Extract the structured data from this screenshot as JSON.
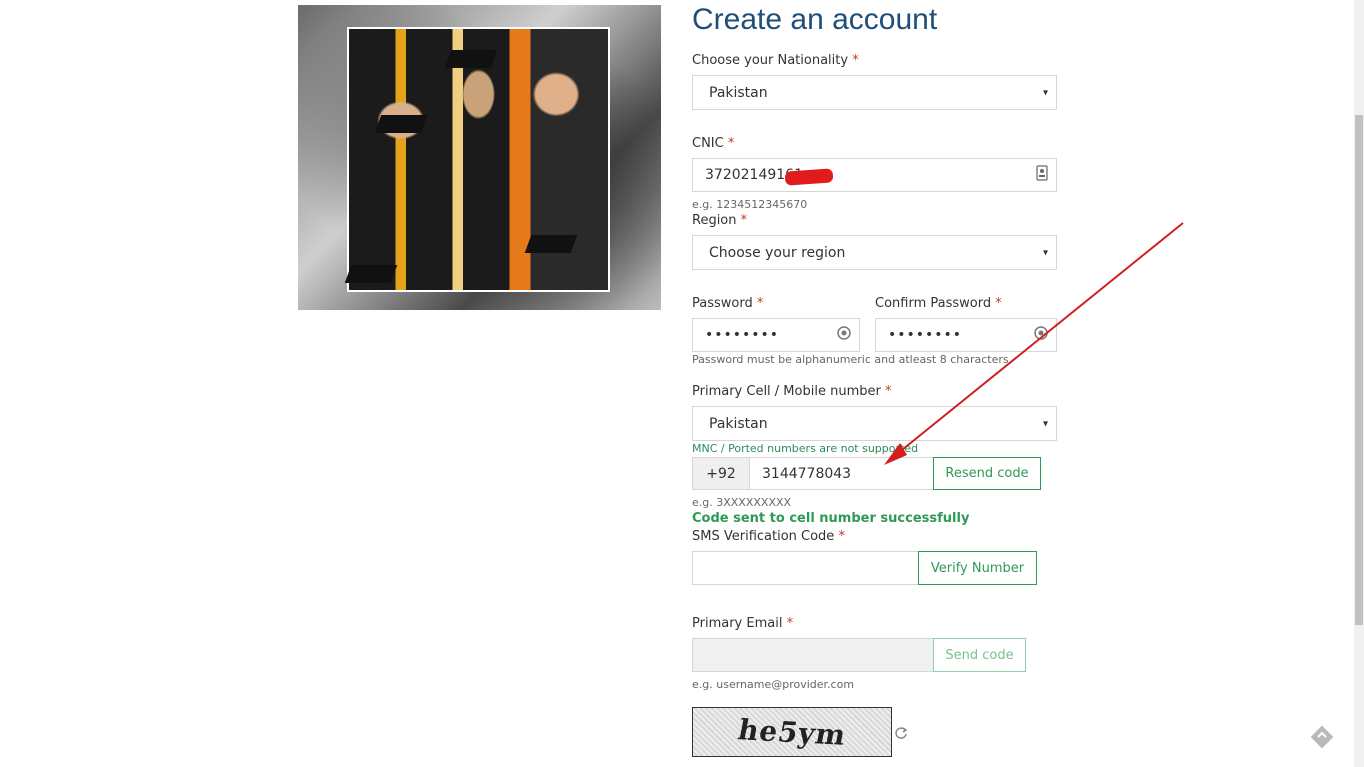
{
  "form": {
    "title": "Create an account",
    "nationality": {
      "label": "Choose your Nationality",
      "required": "*",
      "value": "Pakistan"
    },
    "cnic": {
      "label": "CNIC",
      "required": "*",
      "value": "37202149161",
      "hint": "e.g. 1234512345670"
    },
    "region": {
      "label": "Region",
      "required": "*",
      "value": "Choose your region"
    },
    "password": {
      "label": "Password",
      "required": "*",
      "value": "••••••••"
    },
    "confirm_password": {
      "label": "Confirm Password",
      "required": "*",
      "value": "••••••••"
    },
    "password_hint": "Password must be alphanumeric and atleast 8 characters",
    "mobile": {
      "label": "Primary Cell / Mobile number",
      "required": "*",
      "country": "Pakistan",
      "mnc_note": "MNC / Ported numbers are not supported",
      "prefix": "+92",
      "value": "3144778043",
      "resend_label": "Resend code",
      "hint": "e.g. 3XXXXXXXXX",
      "success": "Code sent to cell number successfully"
    },
    "sms": {
      "label": "SMS Verification Code",
      "required": "*",
      "value": "",
      "verify_label": "Verify Number"
    },
    "email": {
      "label": "Primary Email",
      "required": "*",
      "value": "",
      "send_label": "Send code",
      "hint": "e.g. username@provider.com"
    },
    "captcha": {
      "text": "he5ym"
    }
  },
  "icons": {
    "cnic_icon": "id-card-icon",
    "password_icon": "eye-icon",
    "captcha_refresh": "refresh-icon",
    "select_caret": "▾"
  },
  "colors": {
    "title": "#1e4e79",
    "required": "#c0392b",
    "success": "#2e9a55",
    "annotation_arrow": "#d11f1f"
  }
}
